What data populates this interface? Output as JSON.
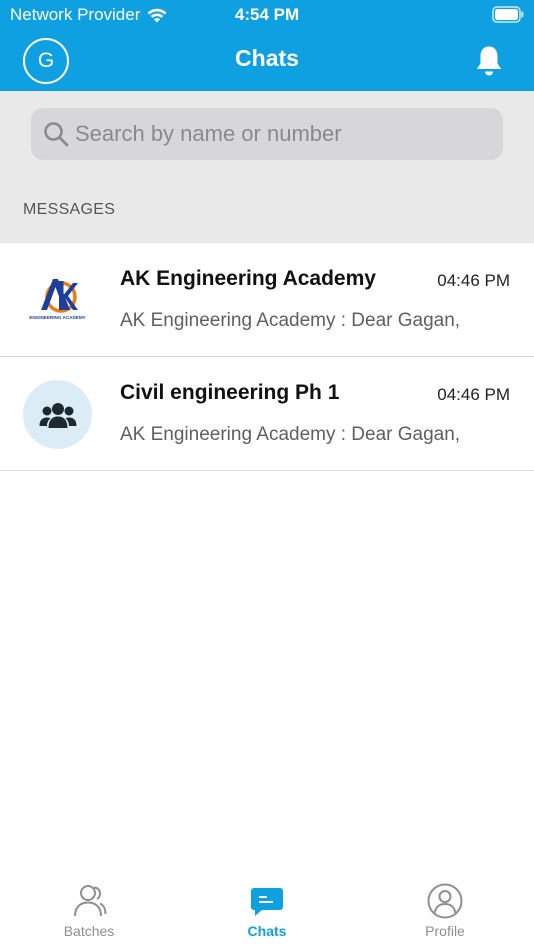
{
  "status_bar": {
    "carrier": "Network Provider",
    "time": "4:54 PM"
  },
  "header": {
    "avatar_letter": "G",
    "title": "Chats"
  },
  "search": {
    "placeholder": "Search by name or number",
    "value": ""
  },
  "section": {
    "title": "MESSAGES"
  },
  "chats": [
    {
      "name": "AK Engineering Academy",
      "time": "04:46 PM",
      "preview": "AK Engineering Academy : Dear Gagan,",
      "avatar": "logo-ak",
      "logo_caption": "ENGINEERING ACADEMY"
    },
    {
      "name": "Civil engineering Ph 1",
      "time": "04:46 PM",
      "preview": "AK Engineering Academy : Dear Gagan,",
      "avatar": "group-icon"
    }
  ],
  "tabs": [
    {
      "label": "Batches",
      "icon": "batches-icon",
      "active": false
    },
    {
      "label": "Chats",
      "icon": "chat-icon",
      "active": true
    },
    {
      "label": "Profile",
      "icon": "profile-icon",
      "active": false
    }
  ],
  "colors": {
    "accent": "#0fa0e2",
    "search_bg": "#e9e9ea",
    "inactive_tab": "#8e8e93",
    "logo_blue": "#1d3f9c",
    "logo_orange": "#f07a12"
  }
}
